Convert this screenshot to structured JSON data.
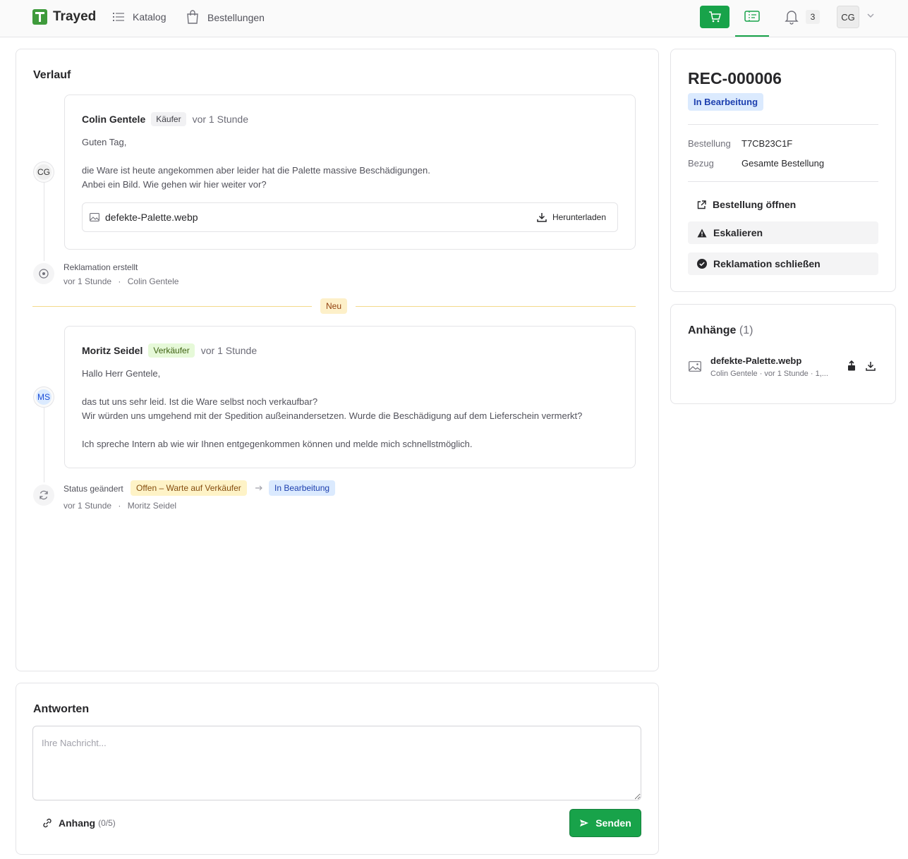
{
  "app": {
    "name": "Trayed"
  },
  "nav": {
    "catalog_label": "Katalog",
    "orders_label": "Bestellungen",
    "notification_count": "3",
    "user_initials": "CG"
  },
  "colors": {
    "accent": "#18a34a",
    "status_blue": "#dbeafe",
    "status_yellow": "#fef3c7"
  },
  "timeline": {
    "title": "Verlauf",
    "message1": {
      "avatar": "CG",
      "author": "Colin Gentele",
      "role": "Käufer",
      "time": "vor 1 Stunde",
      "line1": "Guten Tag,",
      "line2": "die Ware ist heute angekommen aber leider hat die Palette massive Beschädigungen.",
      "line3": "Anbei ein Bild. Wie gehen wir hier weiter vor?",
      "attachment_name": "defekte-Palette.webp",
      "download_label": "Herunterladen"
    },
    "event_created": {
      "title": "Reklamation erstellt",
      "time": "vor 1 Stunde",
      "separator": "·",
      "actor": "Colin Gentele"
    },
    "divider_label": "Neu",
    "message2": {
      "avatar": "MS",
      "author": "Moritz Seidel",
      "role": "Verkäufer",
      "time": "vor 1 Stunde",
      "line1": "Hallo Herr Gentele,",
      "line2": "das tut uns sehr leid. Ist die Ware selbst noch verkaufbar?",
      "line3": "Wir würden uns umgehend mit der Spedition außeinandersetzen. Wurde die Beschädigung auf dem Lieferschein vermerkt?",
      "line4": "Ich spreche Intern ab wie wir Ihnen entgegenkommen können und melde mich schnellstmöglich."
    },
    "event_status": {
      "title": "Status geändert",
      "from": "Offen – Warte auf Verkäufer",
      "to": "In Bearbeitung",
      "time": "vor 1 Stunde",
      "separator": "·",
      "actor": "Moritz Seidel"
    }
  },
  "reply": {
    "title": "Antworten",
    "placeholder": "Ihre Nachricht...",
    "attach_label": "Anhang",
    "attach_count": "(0/5)",
    "send_label": "Senden"
  },
  "sidebar": {
    "rec_id": "REC-000006",
    "status": "In Bearbeitung",
    "order_label": "Bestellung",
    "order_value": "T7CB23C1F",
    "reference_label": "Bezug",
    "reference_value": "Gesamte Bestellung",
    "actions": {
      "open_order": "Bestellung öffnen",
      "escalate": "Eskalieren",
      "close": "Reklamation schließen"
    }
  },
  "attachments": {
    "title": "Anhänge",
    "count": "(1)",
    "file_name": "defekte-Palette.webp",
    "file_meta": "Colin Gentele · vor 1 Stunde · 1,..."
  }
}
